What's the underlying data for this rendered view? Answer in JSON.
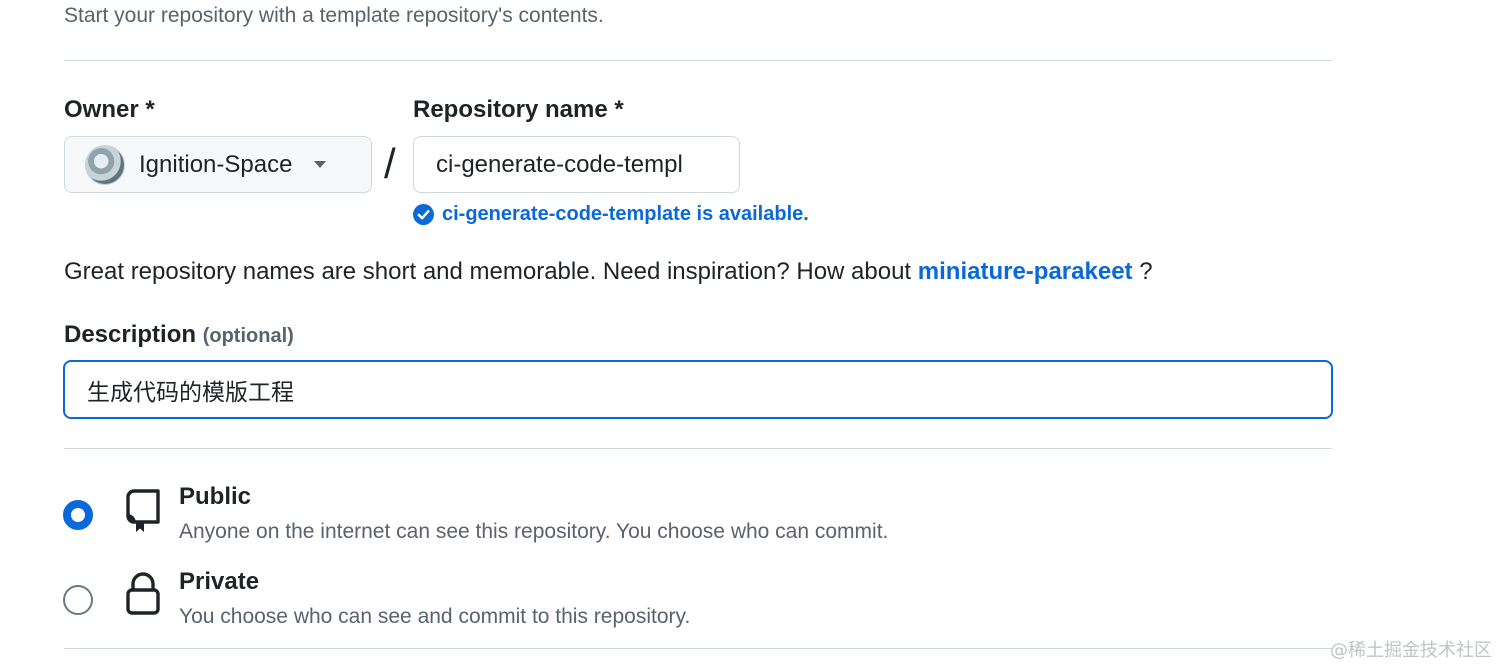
{
  "intro_text": "Start your repository with a template repository's contents.",
  "owner": {
    "label": "Owner *",
    "selected": "Ignition-Space"
  },
  "separator": "/",
  "repo_name": {
    "label": "Repository name *",
    "value": "ci-generate-code-templ",
    "availability": "ci-generate-code-template is available."
  },
  "hint": {
    "text": "Great repository names are short and memorable. Need inspiration? How about",
    "suggestion": "miniature-parakeet",
    "suffix": "?"
  },
  "description": {
    "label": "Description",
    "optional_label": "(optional)",
    "value": "生成代码的模版工程"
  },
  "visibility": {
    "options": [
      {
        "title": "Public",
        "desc": "Anyone on the internet can see this repository. You choose who can commit.",
        "selected": true
      },
      {
        "title": "Private",
        "desc": "You choose who can see and commit to this repository.",
        "selected": false
      }
    ]
  },
  "watermark": "@稀土掘金技术社区",
  "colors": {
    "accent": "#0969da",
    "muted": "#59636e",
    "border": "#d1d9e0"
  }
}
